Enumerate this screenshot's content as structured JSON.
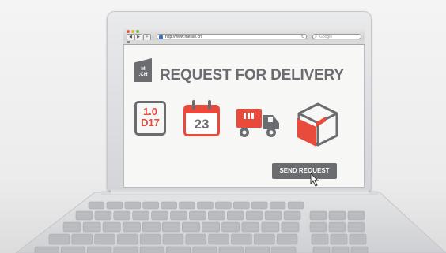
{
  "browser": {
    "url": "http://www.messe.ch",
    "search_placeholder": "Google",
    "search_icon": "magnifier-icon",
    "reload_icon": "reload-icon"
  },
  "logo": {
    "line1": "M",
    "line2": ".CH"
  },
  "page": {
    "headline": "REQUEST FOR DELIVERY",
    "version_line1": "1.0",
    "version_line2": "D17",
    "calendar_day": "23",
    "truck_icon": "truck-icon",
    "box_icon": "open-box-icon",
    "send_button_label": "SEND REQUEST"
  },
  "colors": {
    "accent_red": "#e84a3c",
    "dark_gray": "#6a6c6f"
  }
}
